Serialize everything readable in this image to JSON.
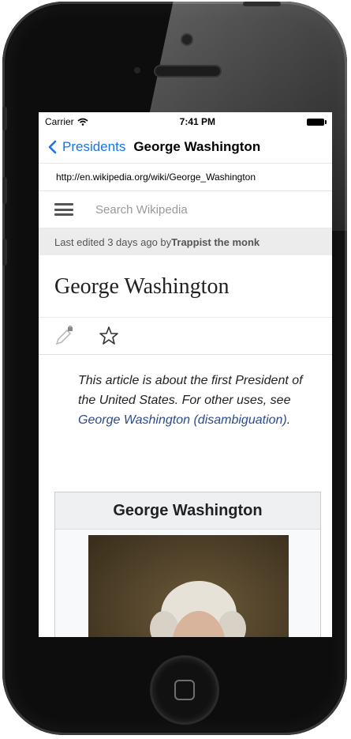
{
  "status": {
    "carrier": "Carrier",
    "time": "7:41 PM"
  },
  "nav": {
    "back_label": "Presidents",
    "title": "George Washington"
  },
  "url": "http://en.wikipedia.org/wiki/George_Washington",
  "search": {
    "placeholder": "Search Wikipedia"
  },
  "edit_info": {
    "prefix": "Last edited 3 days ago by ",
    "user": "Trappist the monk"
  },
  "article": {
    "title": "George Washington",
    "hatnote_text": "This article is about the first President of the United States. For other uses, see ",
    "hatnote_link": "George Washington (disambiguation)",
    "hatnote_end": "."
  },
  "infobox": {
    "title": "George Washington"
  },
  "icons": {
    "back": "chevron-left-icon",
    "menu": "hamburger-icon",
    "edit": "pencil-lock-icon",
    "watch": "star-icon",
    "wifi": "wifi-icon",
    "battery": "battery-icon"
  },
  "colors": {
    "link": "#2a4b8d",
    "ios_blue": "#1a73e8"
  }
}
